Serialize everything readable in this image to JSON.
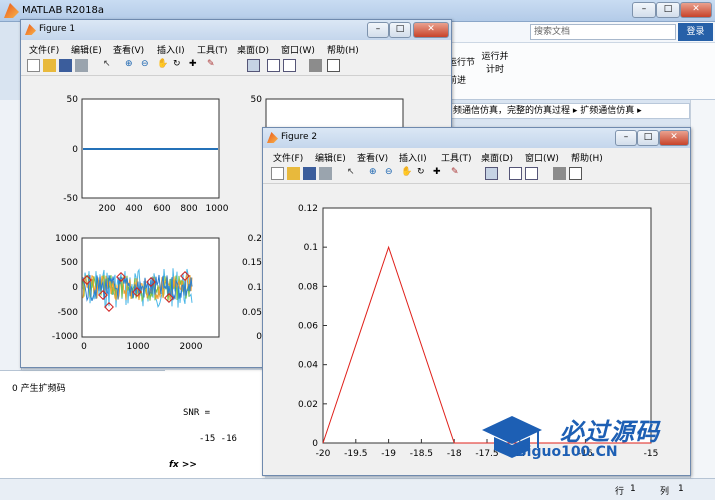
{
  "main": {
    "title": "MATLAB R2018a",
    "search_placeholder": "搜索文档",
    "login": "登录",
    "ribbon": {
      "run_section": "运行节",
      "advance": "前进",
      "run_time": "运行并\n计时"
    },
    "breadcrumb": "频通信仿真，完整的仿真过程 ▸ 扩频通信仿真 ▸",
    "workspace_item": "0 产生扩频码",
    "cmd": {
      "snr": "SNR =",
      "vals": "-15   -16",
      "prompt": "fx >>"
    },
    "status": {
      "row_label": "行",
      "row": "1",
      "col_label": "列",
      "col": "1"
    }
  },
  "figure1": {
    "title": "Figure 1",
    "menu": [
      "文件(F)",
      "编辑(E)",
      "查看(V)",
      "插入(I)",
      "工具(T)",
      "桌面(D)",
      "窗口(W)",
      "帮助(H)"
    ],
    "ax1": {
      "yticks": [
        "50",
        "0",
        "-50"
      ],
      "xticks": [
        "200",
        "400",
        "600",
        "800",
        "1000"
      ]
    },
    "ax2": {
      "yticks": [
        "50"
      ]
    },
    "ax3": {
      "yticks": [
        "1000",
        "500",
        "0",
        "-500",
        "-1000"
      ],
      "xticks": [
        "0",
        "1000",
        "2000"
      ]
    },
    "ax4": {
      "yticks": [
        "0.2",
        "0.15",
        "0.1",
        "0.05",
        "0"
      ]
    }
  },
  "figure2": {
    "title": "Figure 2",
    "menu": [
      "文件(F)",
      "编辑(E)",
      "查看(V)",
      "插入(I)",
      "工具(T)",
      "桌面(D)",
      "窗口(W)",
      "帮助(H)"
    ]
  },
  "chart_data": {
    "type": "line",
    "x": [
      -20,
      -19,
      -18,
      -17,
      -16,
      -15
    ],
    "series": [
      {
        "values": [
          0,
          0.1,
          0,
          0,
          0,
          0
        ],
        "color": "#e0201a"
      }
    ],
    "xlim": [
      -20,
      -15
    ],
    "ylim": [
      0,
      0.12
    ],
    "xticks": [
      "-20",
      "-19.5",
      "-19",
      "-18.5",
      "-18",
      "-17.5",
      "-17",
      "-16",
      "-15"
    ],
    "yticks": [
      "0",
      "0.02",
      "0.04",
      "0.06",
      "0.08",
      "0.1",
      "0.12"
    ]
  },
  "watermark": {
    "text1": "必过源码",
    "text2": "Biguo100.CN"
  }
}
